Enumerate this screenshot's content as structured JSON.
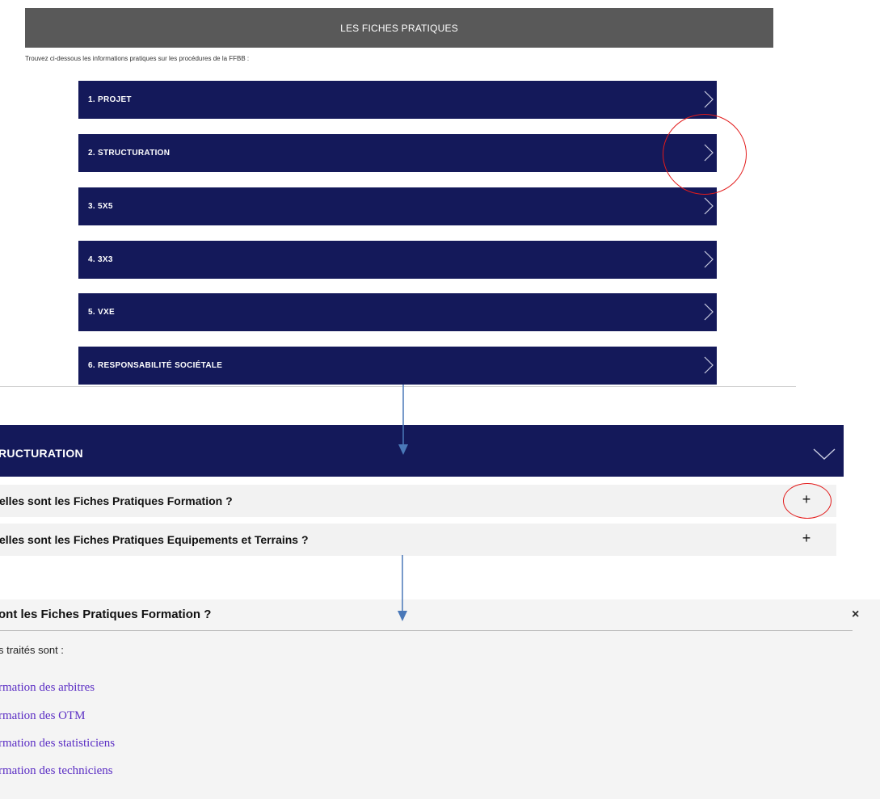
{
  "panel1": {
    "banner_title": "LES FICHES PRATIQUES",
    "intro": "Trouvez ci-dessous les informations pratiques sur les procédures de la FFBB :",
    "accordion_items": [
      {
        "label": "1. PROJET"
      },
      {
        "label": "2. STRUCTURATION"
      },
      {
        "label": "3. 5X5"
      },
      {
        "label": "4. 3X3"
      },
      {
        "label": "5. VXE"
      },
      {
        "label": "6. RESPONSABILITÉ SOCIÉTALE"
      }
    ]
  },
  "panel2": {
    "section_title": "RUCTURATION",
    "faq_items": [
      {
        "question": "elles sont les Fiches Pratiques Formation ?",
        "icon": "plus-icon"
      },
      {
        "question": "elles sont les Fiches Pratiques Equipements et Terrains ?",
        "icon": "plus-icon"
      }
    ]
  },
  "panel3": {
    "title": "ont les Fiches Pratiques Formation ?",
    "close_label": "×",
    "intro": "s traités sont :",
    "links": [
      {
        "label": "rmation des arbitres"
      },
      {
        "label": "rmation des OTM"
      },
      {
        "label": "rmation des statisticiens"
      },
      {
        "label": "rmation des techniciens"
      }
    ]
  },
  "colors": {
    "navy": "#14195a",
    "banner_gray": "#595959",
    "highlight_red": "#e21b1b",
    "arrow_blue": "#4a78b8",
    "link_purple": "#5b2ec4"
  }
}
